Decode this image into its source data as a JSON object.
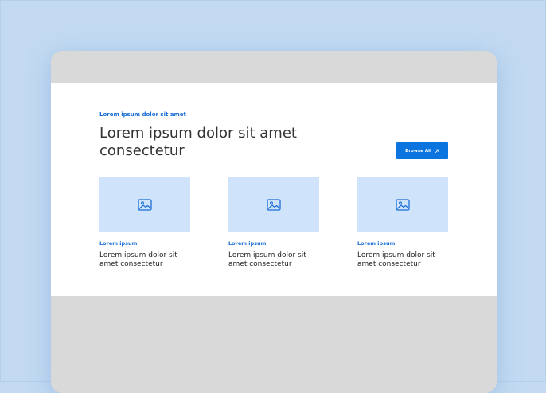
{
  "section": {
    "eyebrow": "Lorem ipsum dolor sit amet",
    "headline": "Lorem ipsum dolor sit amet consectetur",
    "browse_label": "Browse All"
  },
  "cards": [
    {
      "eyebrow": "Lorem ipsum",
      "title": "Lorem ipsum dolor sit amet consectetur",
      "icon": "image-icon"
    },
    {
      "eyebrow": "Lorem ipsum",
      "title": "Lorem ipsum dolor sit amet consectetur",
      "icon": "image-icon"
    },
    {
      "eyebrow": "Lorem ipsum",
      "title": "Lorem ipsum dolor sit amet consectetur",
      "icon": "image-icon"
    }
  ],
  "colors": {
    "background": "#c3daf2",
    "frame": "#d9d9d9",
    "accent": "#0b74de",
    "image_placeholder": "#cfe3fa"
  }
}
